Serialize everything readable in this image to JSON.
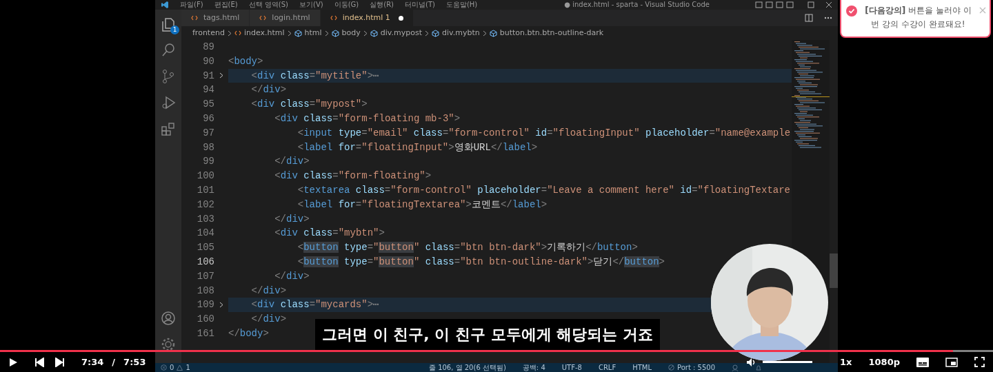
{
  "window": {
    "menu": [
      "파일(F)",
      "편집(E)",
      "선택 영역(S)",
      "보기(V)",
      "이동(G)",
      "실행(R)",
      "터미널(T)",
      "도움말(H)"
    ],
    "title": "● index.html - sparta - Visual Studio Code"
  },
  "activity_bar": {
    "explorer_badge": "1"
  },
  "tabs": [
    {
      "label": "tags.html",
      "selected": false,
      "dirty": false
    },
    {
      "label": "login.html",
      "selected": false,
      "dirty": false
    },
    {
      "label": "index.html 1",
      "selected": true,
      "dirty": true
    }
  ],
  "breadcrumbs": [
    {
      "label": "frontend",
      "kind": "folder"
    },
    {
      "label": "index.html",
      "kind": "file"
    },
    {
      "label": "html",
      "kind": "element"
    },
    {
      "label": "body",
      "kind": "element"
    },
    {
      "label": "div.mypost",
      "kind": "element"
    },
    {
      "label": "div.mybtn",
      "kind": "element"
    },
    {
      "label": "button.btn.btn-outline-dark",
      "kind": "element"
    }
  ],
  "editor": {
    "lines": [
      {
        "number": "89",
        "current": false,
        "folded": false
      },
      {
        "number": "90",
        "current": false,
        "folded": false,
        "tokens": [
          {
            "kind": "punct",
            "text": "<"
          },
          {
            "kind": "tag",
            "text": "body"
          },
          {
            "kind": "punct",
            "text": ">"
          }
        ]
      },
      {
        "number": "91",
        "current": false,
        "folded": true,
        "tokens": [
          {
            "kind": "punct",
            "text": "    <"
          },
          {
            "kind": "tag",
            "text": "div"
          },
          {
            "kind": "attr",
            "text": " class"
          },
          {
            "kind": "punct",
            "text": "="
          },
          {
            "kind": "string",
            "text": "\"mytitle\""
          },
          {
            "kind": "punct",
            "text": ">"
          },
          {
            "kind": "ellipsis",
            "text": "⋯"
          }
        ]
      },
      {
        "number": "94",
        "current": false,
        "folded": false,
        "tokens": [
          {
            "kind": "punct",
            "text": "    </"
          },
          {
            "kind": "tag",
            "text": "div"
          },
          {
            "kind": "punct",
            "text": ">"
          }
        ]
      },
      {
        "number": "95",
        "current": false,
        "folded": false,
        "tokens": [
          {
            "kind": "punct",
            "text": "    <"
          },
          {
            "kind": "tag",
            "text": "div"
          },
          {
            "kind": "attr",
            "text": " class"
          },
          {
            "kind": "punct",
            "text": "="
          },
          {
            "kind": "string",
            "text": "\"mypost\""
          },
          {
            "kind": "punct",
            "text": ">"
          }
        ]
      },
      {
        "number": "96",
        "current": false,
        "folded": false,
        "tokens": [
          {
            "kind": "punct",
            "text": "        <"
          },
          {
            "kind": "tag",
            "text": "div"
          },
          {
            "kind": "attr",
            "text": " class"
          },
          {
            "kind": "punct",
            "text": "="
          },
          {
            "kind": "string",
            "text": "\"form-floating mb-3\""
          },
          {
            "kind": "punct",
            "text": ">"
          }
        ]
      },
      {
        "number": "97",
        "current": false,
        "folded": false,
        "tokens": [
          {
            "kind": "punct",
            "text": "            <"
          },
          {
            "kind": "tag",
            "text": "input"
          },
          {
            "kind": "attr",
            "text": " type"
          },
          {
            "kind": "punct",
            "text": "="
          },
          {
            "kind": "string",
            "text": "\"email\""
          },
          {
            "kind": "attr",
            "text": " class"
          },
          {
            "kind": "punct",
            "text": "="
          },
          {
            "kind": "string",
            "text": "\"form-control\""
          },
          {
            "kind": "attr",
            "text": " id"
          },
          {
            "kind": "punct",
            "text": "="
          },
          {
            "kind": "string",
            "text": "\"floatingInput\""
          },
          {
            "kind": "attr",
            "text": " placeholder"
          },
          {
            "kind": "punct",
            "text": "="
          },
          {
            "kind": "string",
            "text": "\"name@example"
          }
        ]
      },
      {
        "number": "98",
        "current": false,
        "folded": false,
        "tokens": [
          {
            "kind": "punct",
            "text": "            <"
          },
          {
            "kind": "tag",
            "text": "label"
          },
          {
            "kind": "attr",
            "text": " for"
          },
          {
            "kind": "punct",
            "text": "="
          },
          {
            "kind": "string",
            "text": "\"floatingInput\""
          },
          {
            "kind": "punct",
            "text": ">"
          },
          {
            "kind": "plain",
            "text": "영화URL"
          },
          {
            "kind": "punct",
            "text": "</"
          },
          {
            "kind": "tag",
            "text": "label"
          },
          {
            "kind": "punct",
            "text": ">"
          }
        ]
      },
      {
        "number": "99",
        "current": false,
        "folded": false,
        "tokens": [
          {
            "kind": "punct",
            "text": "        </"
          },
          {
            "kind": "tag",
            "text": "div"
          },
          {
            "kind": "punct",
            "text": ">"
          }
        ]
      },
      {
        "number": "100",
        "current": false,
        "folded": false,
        "tokens": [
          {
            "kind": "punct",
            "text": "        <"
          },
          {
            "kind": "tag",
            "text": "div"
          },
          {
            "kind": "attr",
            "text": " class"
          },
          {
            "kind": "punct",
            "text": "="
          },
          {
            "kind": "string",
            "text": "\"form-floating\""
          },
          {
            "kind": "punct",
            "text": ">"
          }
        ]
      },
      {
        "number": "101",
        "current": false,
        "folded": false,
        "tokens": [
          {
            "kind": "punct",
            "text": "            <"
          },
          {
            "kind": "tag",
            "text": "textarea"
          },
          {
            "kind": "attr",
            "text": " class"
          },
          {
            "kind": "punct",
            "text": "="
          },
          {
            "kind": "string",
            "text": "\"form-control\""
          },
          {
            "kind": "attr",
            "text": " placeholder"
          },
          {
            "kind": "punct",
            "text": "="
          },
          {
            "kind": "string",
            "text": "\"Leave a comment here\""
          },
          {
            "kind": "attr",
            "text": " id"
          },
          {
            "kind": "punct",
            "text": "="
          },
          {
            "kind": "string",
            "text": "\"floatingTextare"
          }
        ]
      },
      {
        "number": "102",
        "current": false,
        "folded": false,
        "tokens": [
          {
            "kind": "punct",
            "text": "            <"
          },
          {
            "kind": "tag",
            "text": "label"
          },
          {
            "kind": "attr",
            "text": " for"
          },
          {
            "kind": "punct",
            "text": "="
          },
          {
            "kind": "string",
            "text": "\"floatingTextarea\""
          },
          {
            "kind": "punct",
            "text": ">"
          },
          {
            "kind": "plain",
            "text": "코멘트"
          },
          {
            "kind": "punct",
            "text": "</"
          },
          {
            "kind": "tag",
            "text": "label"
          },
          {
            "kind": "punct",
            "text": ">"
          }
        ]
      },
      {
        "number": "103",
        "current": false,
        "folded": false,
        "tokens": [
          {
            "kind": "punct",
            "text": "        </"
          },
          {
            "kind": "tag",
            "text": "div"
          },
          {
            "kind": "punct",
            "text": ">"
          }
        ]
      },
      {
        "number": "104",
        "current": false,
        "folded": false,
        "tokens": [
          {
            "kind": "punct",
            "text": "        <"
          },
          {
            "kind": "tag",
            "text": "div"
          },
          {
            "kind": "attr",
            "text": " class"
          },
          {
            "kind": "punct",
            "text": "="
          },
          {
            "kind": "string",
            "text": "\"mybtn\""
          },
          {
            "kind": "punct",
            "text": ">"
          }
        ]
      },
      {
        "number": "105",
        "current": false,
        "folded": false,
        "tokens": [
          {
            "kind": "punct",
            "text": "            <"
          },
          {
            "kind": "tag-match",
            "text": "button"
          },
          {
            "kind": "attr",
            "text": " type"
          },
          {
            "kind": "punct",
            "text": "="
          },
          {
            "kind": "string",
            "text": "\""
          },
          {
            "kind": "string-match",
            "text": "button"
          },
          {
            "kind": "string",
            "text": "\""
          },
          {
            "kind": "attr",
            "text": " class"
          },
          {
            "kind": "punct",
            "text": "="
          },
          {
            "kind": "string",
            "text": "\"btn btn-dark\""
          },
          {
            "kind": "punct",
            "text": ">"
          },
          {
            "kind": "plain",
            "text": "기록하기"
          },
          {
            "kind": "punct",
            "text": "</"
          },
          {
            "kind": "tag",
            "text": "button"
          },
          {
            "kind": "punct",
            "text": ">"
          }
        ]
      },
      {
        "number": "106",
        "current": true,
        "folded": false,
        "tokens": [
          {
            "kind": "punct",
            "text": "            <"
          },
          {
            "kind": "tag-match",
            "text": "button"
          },
          {
            "kind": "attr",
            "text": " type"
          },
          {
            "kind": "punct",
            "text": "="
          },
          {
            "kind": "string",
            "text": "\""
          },
          {
            "kind": "string-match",
            "text": "button"
          },
          {
            "kind": "string",
            "text": "\""
          },
          {
            "kind": "attr",
            "text": " class"
          },
          {
            "kind": "punct",
            "text": "="
          },
          {
            "kind": "string",
            "text": "\"btn btn-outline-dark\""
          },
          {
            "kind": "punct",
            "text": ">"
          },
          {
            "kind": "plain",
            "text": "닫기"
          },
          {
            "kind": "punct",
            "text": "</"
          },
          {
            "kind": "tag-match",
            "text": "button"
          },
          {
            "kind": "punct",
            "text": ">"
          }
        ]
      },
      {
        "number": "107",
        "current": false,
        "folded": false,
        "tokens": [
          {
            "kind": "punct",
            "text": "        </"
          },
          {
            "kind": "tag",
            "text": "div"
          },
          {
            "kind": "punct",
            "text": ">"
          }
        ]
      },
      {
        "number": "108",
        "current": false,
        "folded": false,
        "tokens": [
          {
            "kind": "punct",
            "text": "    </"
          },
          {
            "kind": "tag",
            "text": "div"
          },
          {
            "kind": "punct",
            "text": ">"
          }
        ]
      },
      {
        "number": "109",
        "current": false,
        "folded": true,
        "tokens": [
          {
            "kind": "punct",
            "text": "    <"
          },
          {
            "kind": "tag",
            "text": "div"
          },
          {
            "kind": "attr",
            "text": " class"
          },
          {
            "kind": "punct",
            "text": "="
          },
          {
            "kind": "string",
            "text": "\"mycards\""
          },
          {
            "kind": "punct",
            "text": ">"
          },
          {
            "kind": "ellipsis",
            "text": "⋯"
          }
        ]
      },
      {
        "number": "160",
        "current": false,
        "folded": false,
        "tokens": [
          {
            "kind": "punct",
            "text": "    </"
          },
          {
            "kind": "tag",
            "text": "div"
          },
          {
            "kind": "punct",
            "text": ">"
          }
        ]
      },
      {
        "number": "161",
        "current": false,
        "folded": false,
        "tokens": [
          {
            "kind": "punct",
            "text": "</"
          },
          {
            "kind": "tag",
            "text": "body"
          },
          {
            "kind": "punct",
            "text": ">"
          }
        ]
      }
    ]
  },
  "status_bar": {
    "errors": "0",
    "warnings": "1",
    "items": [
      {
        "text": "줄 106, 열 20(6 선택됨)",
        "kind": "text"
      },
      {
        "text": "공백: 4",
        "kind": "text"
      },
      {
        "text": "UTF-8",
        "kind": "text"
      },
      {
        "text": "CRLF",
        "kind": "text"
      },
      {
        "text": "HTML",
        "kind": "text"
      },
      {
        "text": "Port : 5500",
        "kind": "port"
      }
    ]
  },
  "subtitle": "그러면 이 친구, 이 친구 모두에게 해당되는 거죠",
  "toast": {
    "message": "**[다음강의]** 버튼을 눌러야 이번 강의 수강이 완료돼요!"
  },
  "player": {
    "progress": {
      "level": 0.96
    },
    "time_current": "7:34",
    "time_separator": "/",
    "time_total": "7:53",
    "volume": {
      "level": 1
    },
    "speed": "1x",
    "quality": "1080p"
  }
}
